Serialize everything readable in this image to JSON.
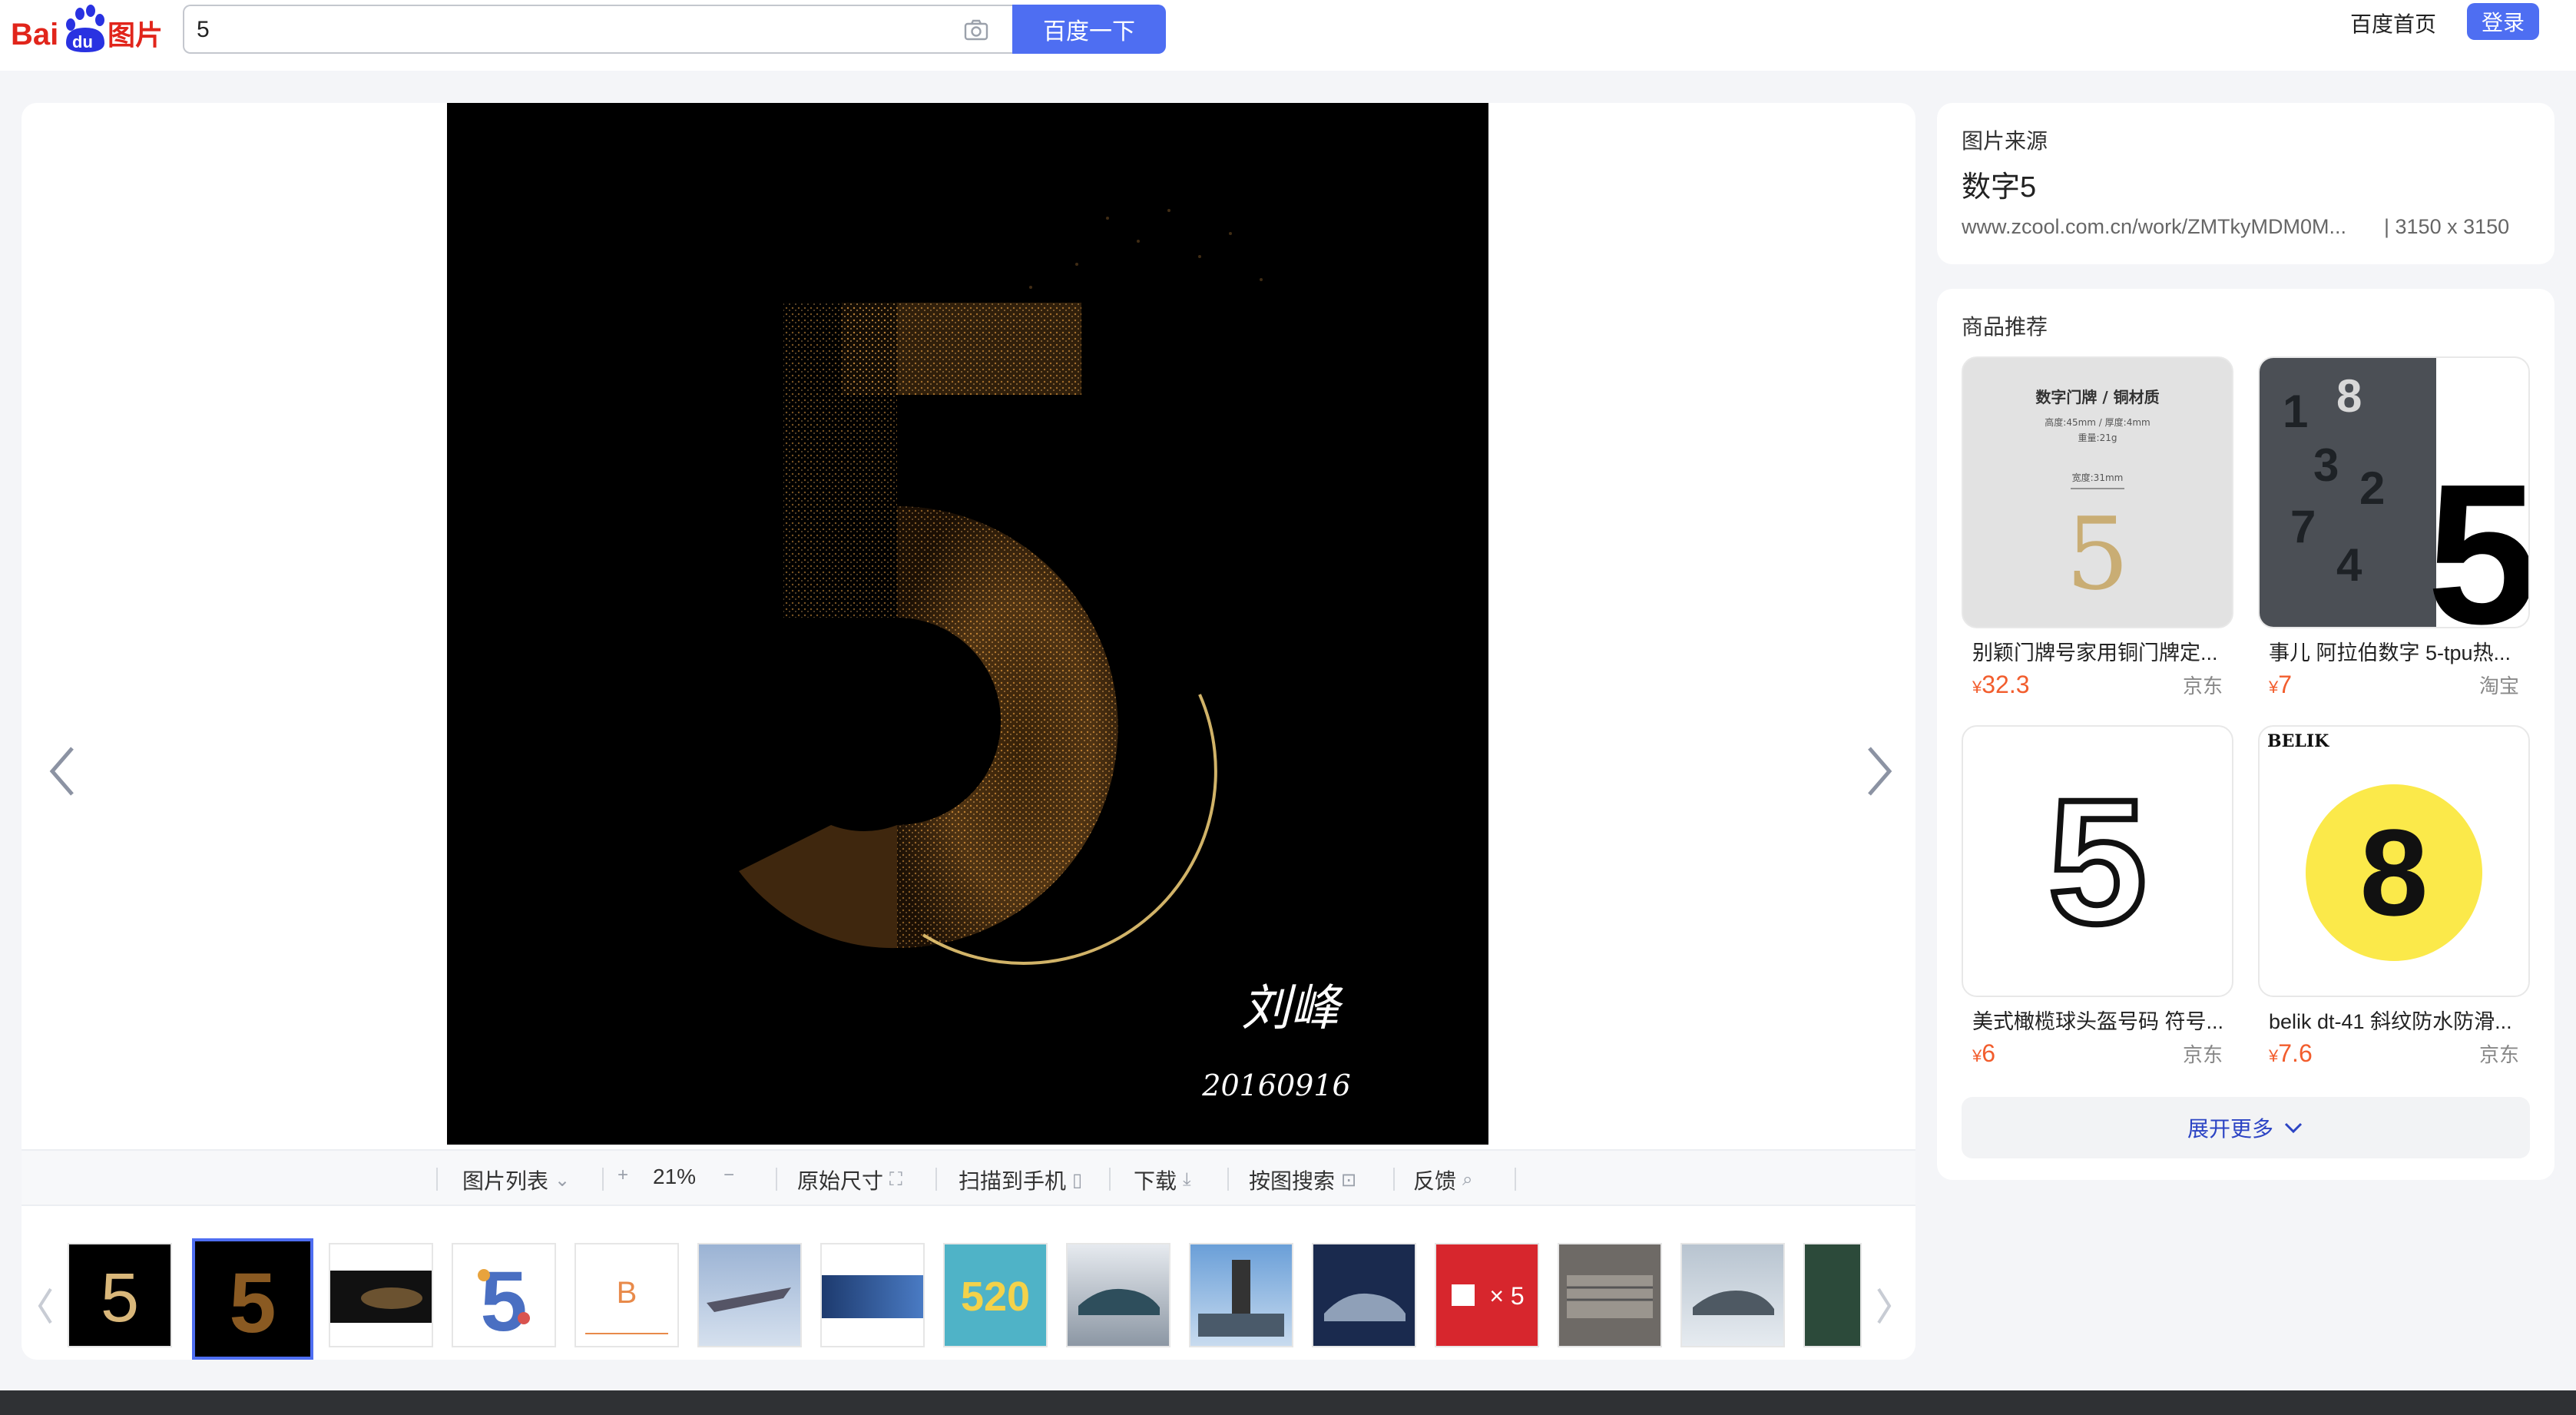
{
  "header": {
    "logo_text_bai": "Bai",
    "logo_text_du": "du",
    "logo_text_tupian": "图片",
    "search_value": "5",
    "search_button": "百度一下",
    "home_link": "百度首页",
    "login_button": "登录"
  },
  "main_image": {
    "signature": "刘峰",
    "date_text": "20160916"
  },
  "toolbar": {
    "list": "图片列表",
    "zoom_in": "+",
    "zoom_level": "21%",
    "zoom_out": "−",
    "original_size": "原始尺寸",
    "scan_phone": "扫描到手机",
    "download": "下载",
    "image_search": "按图搜索",
    "feedback": "反馈"
  },
  "thumbnails": {
    "t5_text": "520",
    "t12_text": "× 5"
  },
  "source": {
    "label": "图片来源",
    "title": "数字5",
    "url": "www.zcool.com.cn/work/ZMTkyMDM0M...",
    "size": "| 3150 x 3150"
  },
  "products": {
    "heading": "商品推荐",
    "currency": "¥",
    "items": [
      {
        "title": "别颖门牌号家用铜门牌定...",
        "price": "32.3",
        "shop": "京东",
        "img_title": "数字门牌 / 铜材质",
        "img_line1": "高度:45mm / 厚度:4mm",
        "img_line2": "重量:21g",
        "img_line3": "宽度:31mm",
        "img_num": "5"
      },
      {
        "title": "事儿 阿拉伯数字 5-tpu热...",
        "price": "7",
        "shop": "淘宝",
        "img_num": "5"
      },
      {
        "title": "美式橄榄球头盔号码 符号...",
        "price": "6",
        "shop": "京东",
        "img_num": "5"
      },
      {
        "title": "belik dt-41 斜纹防水防滑...",
        "price": "7.6",
        "shop": "京东",
        "img_brand": "BELIK",
        "img_num": "8"
      }
    ],
    "more": "展开更多"
  }
}
